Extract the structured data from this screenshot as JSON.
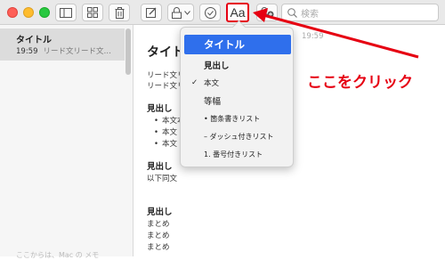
{
  "toolbar": {
    "format_button_label": "Aa",
    "search_placeholder": "検索"
  },
  "sidebar": {
    "note_title": "タイトル",
    "note_time": "19:59",
    "note_preview": "リード文リード文…",
    "bottom_text": "ここからは、Mac の メモ"
  },
  "editor": {
    "title": "タイトル",
    "date": "19:59",
    "lead1": "リード文リード文",
    "lead2": "リード文リード文",
    "heading1": "見出し",
    "bullets": [
      "本文本文",
      "本文",
      "本文"
    ],
    "heading2": "見出し",
    "text2": "以下同文",
    "heading3": "見出し",
    "summary": [
      "まとめ",
      "まとめ",
      "まとめ"
    ]
  },
  "format_menu": {
    "items": [
      {
        "label": "タイトル",
        "selected": true
      },
      {
        "label": "見出し"
      },
      {
        "label": "本文",
        "checked": true,
        "check_mark": "✓"
      },
      {
        "label": "等幅"
      },
      {
        "label": "• 箇条書きリスト"
      },
      {
        "label": "– ダッシュ付きリスト"
      },
      {
        "label": "1. 番号付きリスト"
      }
    ]
  },
  "annotation": {
    "text": "ここをクリック",
    "color": "#e60012"
  },
  "colors": {
    "highlight_blue": "#2f6fec",
    "annotation_red": "#e60012"
  }
}
